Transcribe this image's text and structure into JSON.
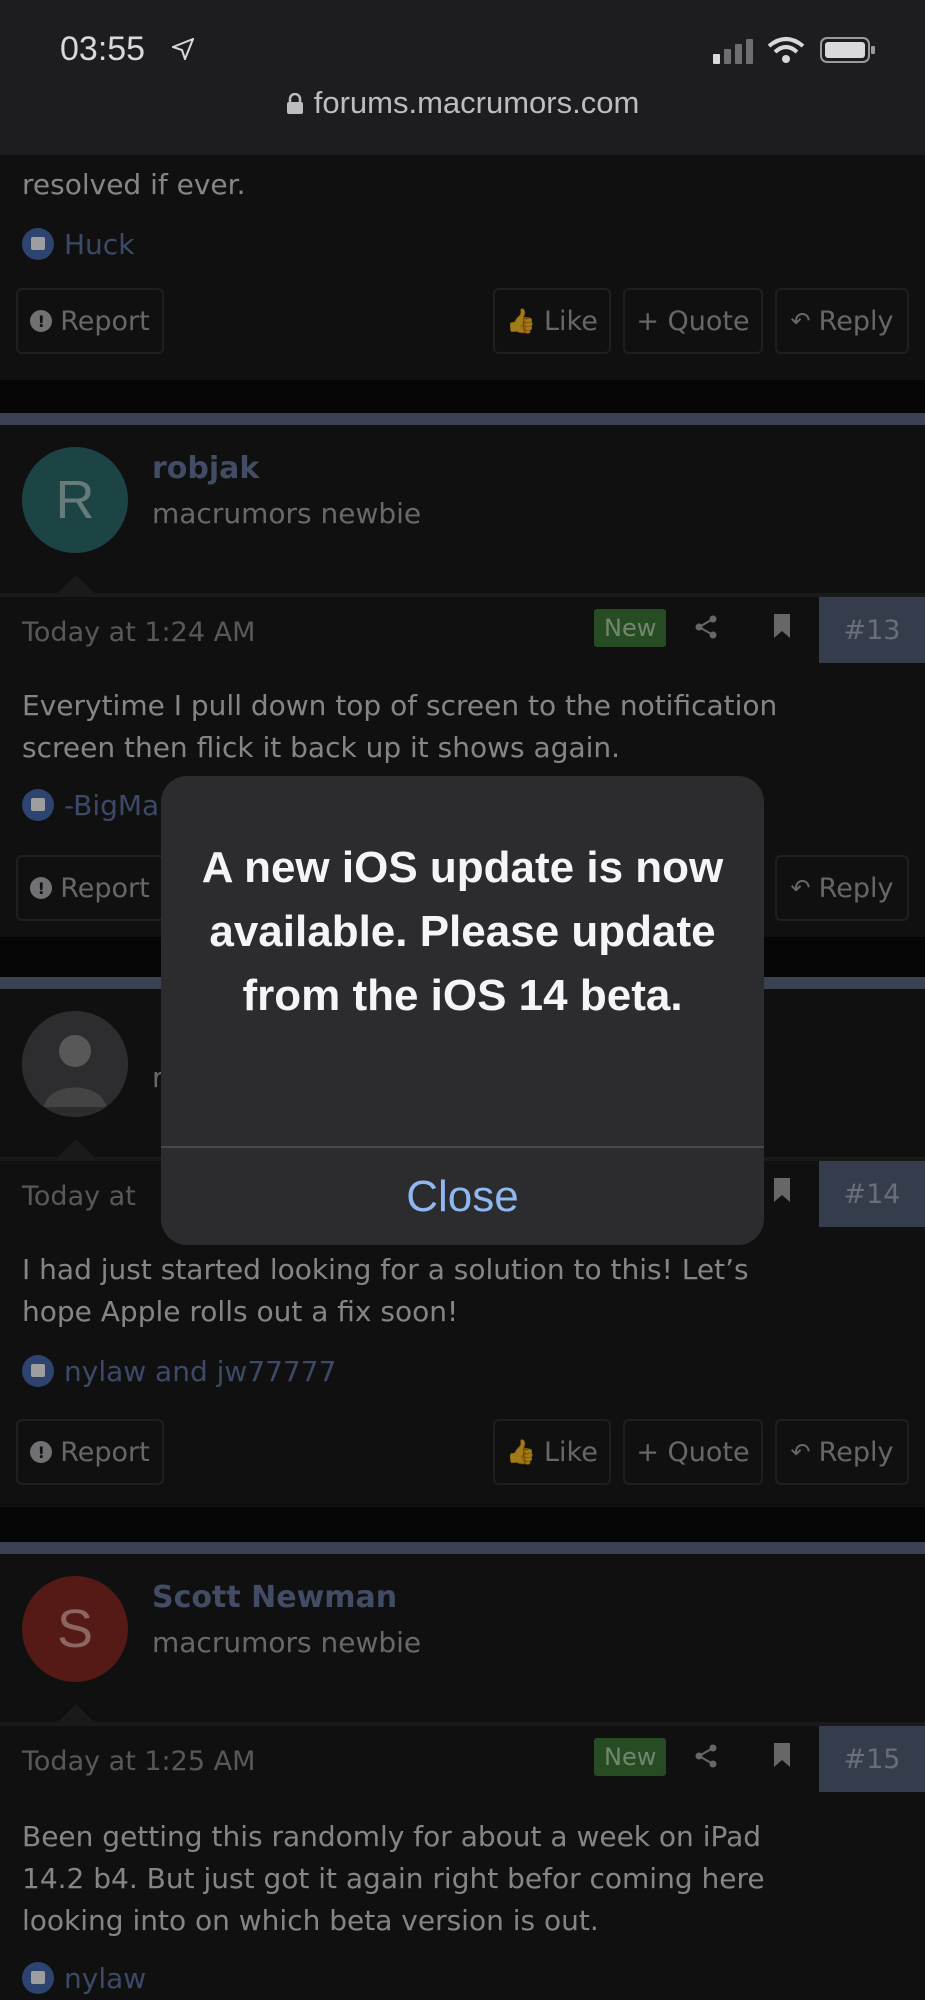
{
  "status_bar": {
    "time": "03:55"
  },
  "browser": {
    "url": "forums.macrumors.com"
  },
  "colors": {
    "accent_link": "#8fb8f2",
    "separator": "#5d6a86",
    "new_badge": "#3f7b3b",
    "post_number_bg": "#566279"
  },
  "actions": {
    "report": "Report",
    "like": "Like",
    "quote": "+ Quote",
    "reply": "Reply"
  },
  "posts": [
    {
      "text_line": "resolved if ever.",
      "likes": "Huck"
    },
    {
      "author": "robjak",
      "author_initial": "R",
      "author_title": "macrumors newbie",
      "date": "Today at 1:24 AM",
      "badge": "New",
      "number": "#13",
      "text_lines": [
        "Everytime I pull down top of screen to the notification",
        "screen then flick it back up it shows again."
      ],
      "likes": "-BigMa"
    },
    {
      "author_title_partial": "r",
      "date": "Today at",
      "number": "#14",
      "text_lines": [
        "I had just started looking for a solution to this! Let’s",
        "hope Apple rolls out a fix soon!"
      ],
      "likes": "nylaw and jw77777"
    },
    {
      "author": "Scott Newman",
      "author_initial": "S",
      "author_title": "macrumors newbie",
      "date": "Today at 1:25 AM",
      "badge": "New",
      "number": "#15",
      "text_lines": [
        "Been getting this randomly for about a week on iPad",
        "14.2 b4. But just got it again right befor coming here",
        "looking into on which beta version is out."
      ],
      "likes": "nylaw"
    }
  ],
  "alert": {
    "message": "A new iOS update is now available. Please update from the iOS 14 beta.",
    "close_label": "Close"
  }
}
